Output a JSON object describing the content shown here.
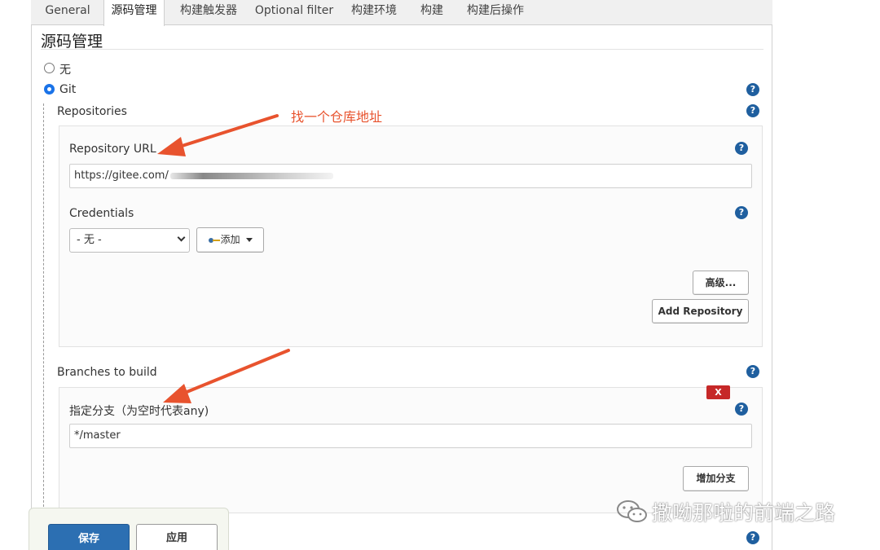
{
  "tabs": [
    {
      "label": "General"
    },
    {
      "label": "源码管理"
    },
    {
      "label": "构建触发器"
    },
    {
      "label": "Optional filter"
    },
    {
      "label": "构建环境"
    },
    {
      "label": "构建"
    },
    {
      "label": "构建后操作"
    }
  ],
  "active_tab": "源码管理",
  "section_title": "源码管理",
  "scm_options": {
    "none_label": "无",
    "git_label": "Git",
    "selected": "Git"
  },
  "repositories": {
    "label": "Repositories",
    "url_label": "Repository URL",
    "url_value": "https://gitee.com/",
    "credentials_label": "Credentials",
    "credentials_selected": "- 无 -",
    "add_button": "添加",
    "advanced_button": "高级...",
    "add_repository_button": "Add Repository"
  },
  "branches": {
    "label": "Branches to build",
    "branch_label": "指定分支（为空时代表any)",
    "branch_value": "*/master",
    "delete_button": "X",
    "add_branch_button": "增加分支"
  },
  "help_icon_glyph": "?",
  "footer": {
    "save_button": "保存",
    "apply_button": "应用"
  },
  "annotations": {
    "repo_note": "找一个仓库地址"
  },
  "watermark": "撒呦那啦的前端之路",
  "colors": {
    "accent_blue": "#2c6fb2",
    "help_icon": "#1f5f9f",
    "annotation_red": "#e8532e",
    "delete_red": "#c62828"
  }
}
